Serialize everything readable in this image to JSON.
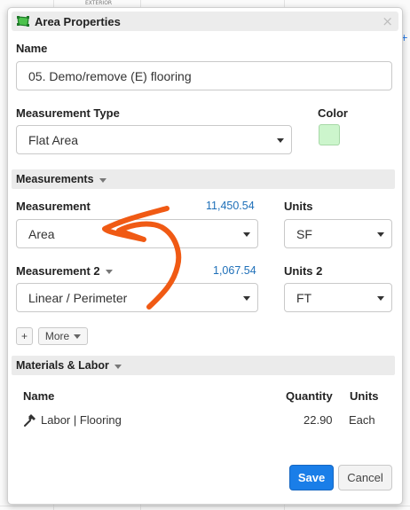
{
  "background": {
    "snippet": "EXTERIOR",
    "right_icon": "+"
  },
  "dialog": {
    "title": "Area Properties",
    "close_glyph": "×"
  },
  "name_field": {
    "label": "Name",
    "value": "05. Demo/remove (E) flooring"
  },
  "measurement_type": {
    "label": "Measurement Type",
    "value": "Flat Area"
  },
  "color": {
    "label": "Color",
    "value": "#ccf5cc"
  },
  "measurements_section": {
    "title": "Measurements",
    "measurement": {
      "label": "Measurement",
      "total": "11,450.54",
      "value": "Area"
    },
    "units": {
      "label": "Units",
      "value": "SF"
    },
    "measurement_2": {
      "label": "Measurement 2",
      "total": "1,067.54",
      "value": "Linear / Perimeter"
    },
    "units_2": {
      "label": "Units 2",
      "value": "FT"
    },
    "add_label": "+",
    "more_label": "More"
  },
  "materials_section": {
    "title": "Materials & Labor",
    "columns": {
      "name": "Name",
      "quantity": "Quantity",
      "units": "Units"
    },
    "rows": [
      {
        "name": "Labor | Flooring",
        "quantity": "22.90",
        "units": "Each",
        "icon": "hammer-icon"
      }
    ]
  },
  "footer": {
    "save_label": "Save",
    "cancel_label": "Cancel"
  },
  "colors": {
    "accent": "#1a7ee8",
    "link_number": "#1e6fb8",
    "annotation": "#f05a14",
    "title_icon": "#2e9e3e"
  }
}
